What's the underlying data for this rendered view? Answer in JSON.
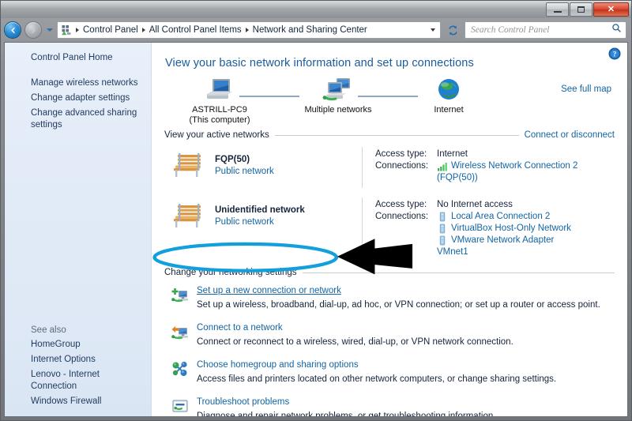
{
  "window": {
    "controls": {
      "minimize_label": "Minimize",
      "maximize_label": "Maximize",
      "close_label": "Close"
    }
  },
  "navbar": {
    "back_label": "Back",
    "forward_label": "Forward",
    "recent_pages_label": "Recent pages",
    "breadcrumbs": [
      "Control Panel",
      "All Control Panel Items",
      "Network and Sharing Center"
    ],
    "refresh_label": "Refresh",
    "search_placeholder": "Search Control Panel",
    "search_value": ""
  },
  "sidebar": {
    "home_label": "Control Panel Home",
    "items": [
      {
        "label": "Manage wireless networks"
      },
      {
        "label": "Change adapter settings"
      },
      {
        "label": "Change advanced sharing settings"
      }
    ],
    "see_also_label": "See also",
    "see_also": [
      {
        "label": "HomeGroup"
      },
      {
        "label": "Internet Options"
      },
      {
        "label": "Lenovo - Internet Connection"
      },
      {
        "label": "Windows Firewall"
      }
    ]
  },
  "main": {
    "help_label": "Help",
    "page_title": "View your basic network information and set up connections",
    "network_map": {
      "see_full_map_label": "See full map",
      "nodes": [
        {
          "name": "ASTRILL-PC9",
          "sub": "(This computer)",
          "icon": "computer-icon"
        },
        {
          "name": "Multiple networks",
          "sub": "",
          "icon": "multiple-networks-icon"
        },
        {
          "name": "Internet",
          "sub": "",
          "icon": "globe-icon"
        }
      ]
    },
    "active_networks": {
      "heading": "View your active networks",
      "action_link": "Connect or disconnect",
      "networks": [
        {
          "name": "FQP(50)",
          "type": "Public network",
          "access_type_label": "Access type:",
          "access_type_value": "Internet",
          "connections_label": "Connections:",
          "connections": [
            {
              "icon": "wifi-signal-icon",
              "text": "Wireless Network Connection 2",
              "continuation": "(FQP(50))"
            }
          ]
        },
        {
          "name": "Unidentified network",
          "type": "Public network",
          "access_type_label": "Access type:",
          "access_type_value": "No Internet access",
          "connections_label": "Connections:",
          "connections": [
            {
              "icon": "ethernet-icon",
              "text": "Local Area Connection 2",
              "continuation": ""
            },
            {
              "icon": "ethernet-icon",
              "text": "VirtualBox Host-Only Network",
              "continuation": ""
            },
            {
              "icon": "ethernet-icon",
              "text": "VMware Network Adapter",
              "continuation": "VMnet1"
            }
          ]
        }
      ]
    },
    "settings_section": {
      "heading": "Change your networking settings",
      "tasks": [
        {
          "icon": "new-connection-icon",
          "title": "Set up a new connection or network",
          "desc": "Set up a wireless, broadband, dial-up, ad hoc, or VPN connection; or set up a router or access point.",
          "highlighted": true
        },
        {
          "icon": "connect-network-icon",
          "title": "Connect to a network",
          "desc": "Connect or reconnect to a wireless, wired, dial-up, or VPN network connection.",
          "highlighted": false
        },
        {
          "icon": "homegroup-icon",
          "title": "Choose homegroup and sharing options",
          "desc": "Access files and printers located on other network computers, or change sharing settings.",
          "highlighted": false
        },
        {
          "icon": "troubleshoot-icon",
          "title": "Troubleshoot problems",
          "desc": "Diagnose and repair network problems, or get troubleshooting information.",
          "highlighted": false
        }
      ]
    }
  },
  "annotations": {
    "ellipse_color": "#12a0dc",
    "arrow_color": "#000000",
    "ellipse_target": "Set up a new connection or network",
    "arrow_target": "Set up a new connection or network"
  }
}
